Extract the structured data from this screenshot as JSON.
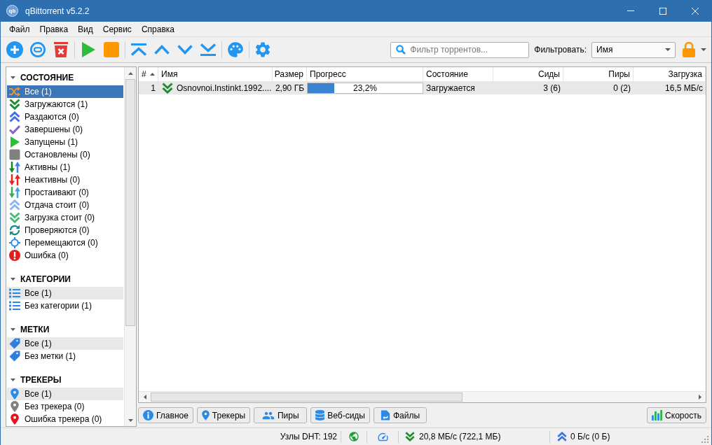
{
  "window": {
    "logo": "qb",
    "title": "qBittorrent v5.2.2"
  },
  "menu": [
    {
      "label": "Файл"
    },
    {
      "label": "Правка"
    },
    {
      "label": "Вид"
    },
    {
      "label": "Сервис"
    },
    {
      "label": "Справка"
    }
  ],
  "toolbar": {
    "search": {
      "placeholder": "Фильтр торрентов..."
    },
    "filter_label": "Фильтровать:",
    "filter_by": "Имя"
  },
  "sidebar": {
    "sections": [
      {
        "title": "СОСТОЯНИЕ",
        "expanded": true,
        "focused": true,
        "items": [
          {
            "label": "Все (1)",
            "kind": "all",
            "selected": true
          },
          {
            "label": "Загружаются (1)",
            "kind": "downloading",
            "selected": false
          },
          {
            "label": "Раздаются (0)",
            "kind": "seeding",
            "selected": false
          },
          {
            "label": "Завершены (0)",
            "kind": "completed",
            "selected": false
          },
          {
            "label": "Запущены (1)",
            "kind": "running",
            "selected": false
          },
          {
            "label": "Остановлены (0)",
            "kind": "stopped",
            "selected": false
          },
          {
            "label": "Активны (1)",
            "kind": "active",
            "selected": false
          },
          {
            "label": "Неактивны (0)",
            "kind": "inactive",
            "selected": false
          },
          {
            "label": "Простаивают (0)",
            "kind": "stalled",
            "selected": false
          },
          {
            "label": "Отдача стоит (0)",
            "kind": "stalled_uploading",
            "selected": false
          },
          {
            "label": "Загрузка стоит (0)",
            "kind": "stalled_downloading",
            "selected": false
          },
          {
            "label": "Проверяются (0)",
            "kind": "checking",
            "selected": false
          },
          {
            "label": "Перемещаются (0)",
            "kind": "moving",
            "selected": false
          },
          {
            "label": "Ошибка (0)",
            "kind": "errored",
            "selected": false
          }
        ]
      },
      {
        "title": "КАТЕГОРИИ",
        "expanded": true,
        "focused": false,
        "items": [
          {
            "label": "Все (1)",
            "kind": "category_all",
            "selected": true
          },
          {
            "label": "Без категории (1)",
            "kind": "uncategorized",
            "selected": false
          }
        ]
      },
      {
        "title": "МЕТКИ",
        "expanded": true,
        "focused": false,
        "items": [
          {
            "label": "Все (1)",
            "kind": "tag_all",
            "selected": true
          },
          {
            "label": "Без метки (1)",
            "kind": "untagged",
            "selected": false
          }
        ]
      },
      {
        "title": "ТРЕКЕРЫ",
        "expanded": true,
        "focused": false,
        "items": [
          {
            "label": "Все (1)",
            "kind": "tracker_all",
            "selected": true
          },
          {
            "label": "Без трекера (0)",
            "kind": "trackerless",
            "selected": false
          },
          {
            "label": "Ошибка трекера (0)",
            "kind": "tracker_error",
            "selected": false
          }
        ]
      }
    ]
  },
  "table": {
    "columns": [
      {
        "label": "#",
        "kind": "index",
        "sorted": true
      },
      {
        "label": "Имя",
        "kind": "name",
        "sorted": false
      },
      {
        "label": "Размер",
        "kind": "size",
        "sorted": false
      },
      {
        "label": "Прогресс",
        "kind": "progress",
        "sorted": false
      },
      {
        "label": "Состояние",
        "kind": "status",
        "sorted": false
      },
      {
        "label": "Сиды",
        "kind": "count",
        "sorted": false
      },
      {
        "label": "Пиры",
        "kind": "count",
        "sorted": false
      },
      {
        "label": "Загрузка",
        "kind": "speed",
        "sorted": false
      }
    ],
    "rows": [
      {
        "selected": true,
        "kind": "downloading",
        "cells": [
          "1",
          "Osnovnoi.Instinkt.1992....",
          "2,90 ГБ",
          {
            "text": "23,2%",
            "level": 0.232
          },
          "Загружается",
          "3 (6)",
          "0 (2)",
          "16,5 МБ/с"
        ]
      }
    ]
  },
  "detail_tabs": [
    {
      "label": "Главное",
      "kind": "general",
      "selected": false
    },
    {
      "label": "Трекеры",
      "kind": "trackers",
      "selected": false
    },
    {
      "label": "Пиры",
      "kind": "peers",
      "selected": false
    },
    {
      "label": "Веб-сиды",
      "kind": "http_sources",
      "selected": false
    },
    {
      "label": "Файлы",
      "kind": "content",
      "selected": false
    }
  ],
  "speed_button": {
    "label": "Скорость"
  },
  "status_bar": {
    "dht": "Узлы DHT: 192",
    "connected": true,
    "alt_speed_limits": false,
    "download": "20,8 МБ/с (722,1 МБ)",
    "upload": "0 Б/с (0 Б)"
  }
}
